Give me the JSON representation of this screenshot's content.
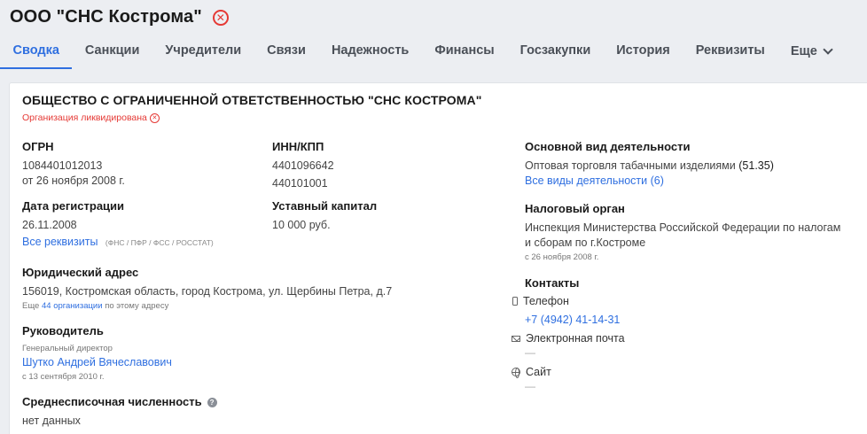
{
  "header": {
    "title": "ООО \"СНС Кострома\"",
    "status_icon": "x-circle-icon"
  },
  "tabs": [
    {
      "label": "Сводка",
      "active": true
    },
    {
      "label": "Санкции"
    },
    {
      "label": "Учредители"
    },
    {
      "label": "Связи"
    },
    {
      "label": "Надежность"
    },
    {
      "label": "Финансы"
    },
    {
      "label": "Госзакупки"
    },
    {
      "label": "История"
    },
    {
      "label": "Реквизиты"
    },
    {
      "label": "Еще"
    }
  ],
  "company": {
    "full_name": "ОБЩЕСТВО С ОГРАНИЧЕННОЙ ОТВЕТСТВЕННОСТЬЮ \"СНС КОСТРОМА\"",
    "status": "Организация ликвидирована"
  },
  "ogrn": {
    "label": "ОГРН",
    "value": "1084401012013",
    "date": "от 26 ноября 2008 г."
  },
  "inn": {
    "label": "ИНН/КПП",
    "inn": "4401096642",
    "kpp": "440101001"
  },
  "registration": {
    "label": "Дата регистрации",
    "value": "26.11.2008",
    "all_link": "Все реквизиты",
    "sources": "(ФНС / ПФР / ФСС / РОССТАТ)"
  },
  "capital": {
    "label": "Уставный капитал",
    "value": "10 000 руб."
  },
  "address": {
    "label": "Юридический адрес",
    "value": "156019, Костромская область, город Кострома, ул. Щербины Петра, д.7",
    "more_prefix": "Еще",
    "more_link": "44 организации",
    "more_suffix": "по этому адресу"
  },
  "head": {
    "label": "Руководитель",
    "role": "Генеральный директор",
    "name": "Шутко Андрей Вячеславович",
    "since": "с 13 сентября 2010 г."
  },
  "headcount": {
    "label": "Среднесписочная численность",
    "value": "нет данных"
  },
  "activity": {
    "label": "Основной вид деятельности",
    "value": "Оптовая торговля табачными изделиями",
    "code": "(51.35)",
    "all_link": "Все виды деятельности (6)"
  },
  "tax": {
    "label": "Налоговый орган",
    "line1": "Инспекция Министерства Российской Федерации по налогам",
    "line2": "и сборам по г.Костроме",
    "date": "с 26 ноября 2008 г."
  },
  "contacts": {
    "label": "Контакты",
    "phone_label": "Телефон",
    "phone": "+7 (4942) 41-14-31",
    "email_label": "Электронная почта",
    "email": "—",
    "site_label": "Сайт",
    "site": "—"
  },
  "colors": {
    "accent": "#2f6fe0",
    "danger": "#e53935",
    "background": "#eceef2"
  }
}
